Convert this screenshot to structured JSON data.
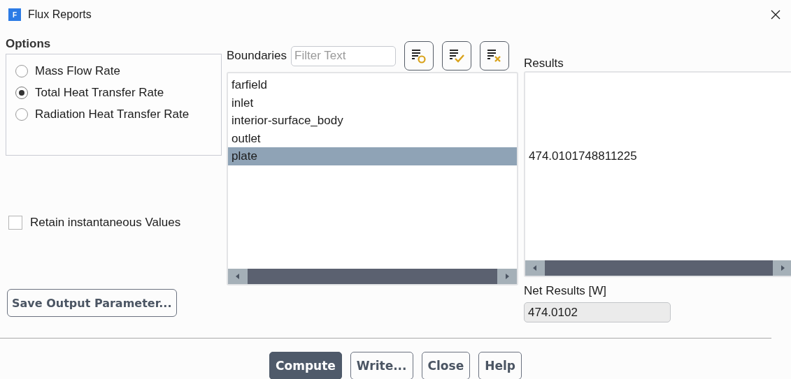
{
  "window": {
    "title": "Flux Reports",
    "app_letter": "F"
  },
  "options": {
    "label": "Options",
    "items": [
      {
        "label": "Mass Flow Rate",
        "selected": false
      },
      {
        "label": "Total Heat Transfer Rate",
        "selected": true
      },
      {
        "label": "Radiation Heat Transfer Rate",
        "selected": false
      }
    ]
  },
  "retain": {
    "label": "Retain instantaneous Values",
    "checked": false
  },
  "save_button": "Save Output Parameter...",
  "boundaries": {
    "label": "Boundaries",
    "filter": {
      "placeholder": "Filter Text"
    },
    "items": [
      {
        "name": "farfield",
        "selected": false
      },
      {
        "name": "inlet",
        "selected": false
      },
      {
        "name": "interior-surface_body",
        "selected": false
      },
      {
        "name": "outlet",
        "selected": false
      },
      {
        "name": "plate",
        "selected": true,
        "result": "474.0101748811225"
      }
    ]
  },
  "results": {
    "label": "Results"
  },
  "net_results": {
    "label": "Net Results [W]",
    "value": "474.0102"
  },
  "buttons": [
    {
      "label": "Compute",
      "primary": true
    },
    {
      "label": "Write...",
      "primary": false
    },
    {
      "label": "Close",
      "primary": false
    },
    {
      "label": "Help",
      "primary": false
    }
  ]
}
